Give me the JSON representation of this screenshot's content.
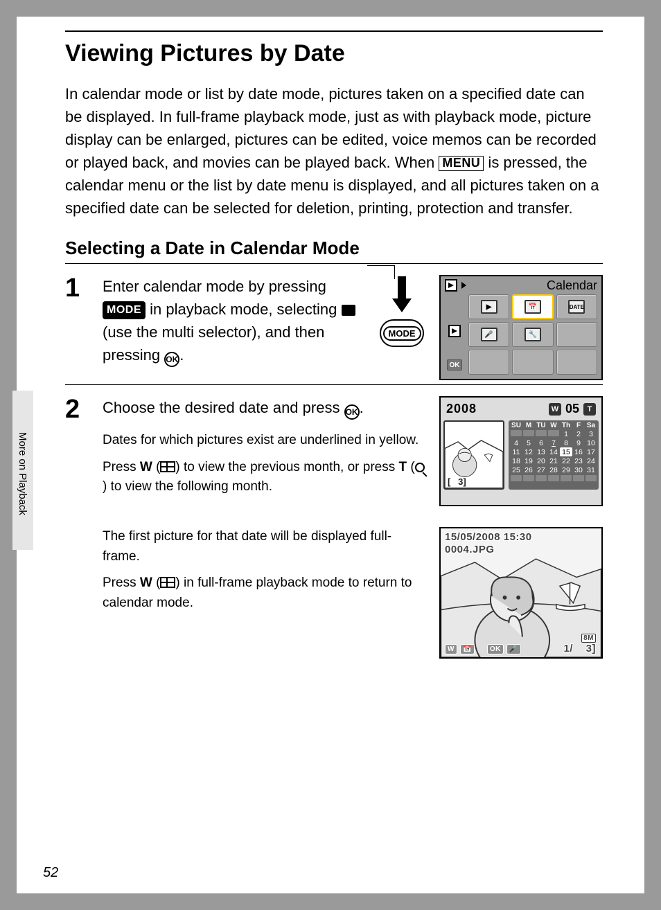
{
  "page_number": "52",
  "side_tab": "More on Playback",
  "title": "Viewing Pictures by Date",
  "intro_part1": "In calendar mode or list by date mode, pictures taken on a specified date can be displayed. In full-frame playback mode, just as with playback mode, picture display can be enlarged, pictures can be edited, voice memos can be recorded or played back, and movies can be played back. When ",
  "intro_menu_label": "MENU",
  "intro_part2": " is pressed, the calendar menu or the list by date menu is displayed, and all pictures taken on a specified date can be selected for deletion, printing, protection and transfer.",
  "subtitle": "Selecting a Date in Calendar Mode",
  "step1": {
    "num": "1",
    "t1": "Enter calendar mode by pressing ",
    "mode_label": "MODE",
    "t2": " in playback mode, selecting ",
    "t3": " (use the multi selector), and then pressing ",
    "ok": "OK",
    "t4": "."
  },
  "mode_btn_label": "MODE",
  "lcd1": {
    "title": "Calendar",
    "ok": "OK",
    "date_label": "DATE"
  },
  "step2": {
    "num": "2",
    "t1": "Choose the desired date and press ",
    "ok": "OK",
    "t2": ".",
    "sub1": "Dates for which pictures exist are underlined in yellow.",
    "sub2a": "Press ",
    "W": "W",
    "sub2b": " (",
    "sub2c": ") to view the previous month, or press ",
    "T": "T",
    "sub2d": " (",
    "sub2e": ") to view the following month.",
    "sub3": "The first picture for that date will be displayed full-frame.",
    "sub4a": "Press ",
    "sub4b": " (",
    "sub4c": ") in full-frame playback mode to return to calendar mode."
  },
  "lcd2": {
    "year": "2008",
    "month": "05",
    "dow": [
      "SU",
      "M",
      "TU",
      "W",
      "Th",
      "F",
      "Sa"
    ],
    "rows": [
      [
        "",
        "",
        "",
        "",
        "1",
        "2",
        "3"
      ],
      [
        "4",
        "5",
        "6",
        "7",
        "8",
        "9",
        "10"
      ],
      [
        "11",
        "12",
        "13",
        "14",
        "15",
        "16",
        "17"
      ],
      [
        "18",
        "19",
        "20",
        "21",
        "22",
        "23",
        "24"
      ],
      [
        "25",
        "26",
        "27",
        "28",
        "29",
        "30",
        "31"
      ],
      [
        "",
        "",
        "",
        "",
        "",
        "",
        ""
      ]
    ],
    "underlined": [
      "7"
    ],
    "selected": "15",
    "thumb_count": "3",
    "W": "W",
    "T": "T"
  },
  "lcd3": {
    "timestamp": "15/05/2008 15:30",
    "filename": "0004.JPG",
    "counter_cur": "1",
    "counter_sep": "/",
    "counter_tot": "3",
    "size_badge": "8M",
    "ok": "OK"
  }
}
